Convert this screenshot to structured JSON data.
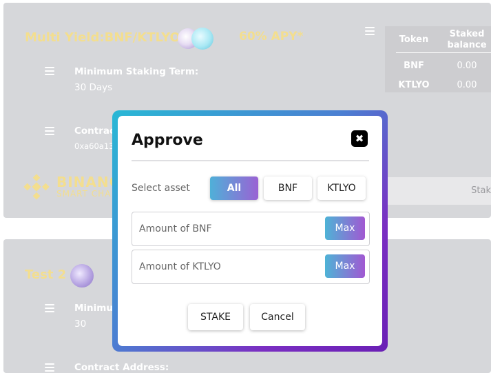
{
  "pool1": {
    "title": "Multi Yield:BNF/KTLYO",
    "apy": "60% APY*",
    "min_term_label": "Minimum Staking Term:",
    "min_term_value": "30 Days",
    "contract_label": "Contrac",
    "contract_value": "0xa60a13",
    "table": {
      "col_token": "Token",
      "col_staked_1": "Staked",
      "col_staked_2": "balance",
      "rows": [
        {
          "token": "BNF",
          "staked": "0.00"
        },
        {
          "token": "KTLYO",
          "staked": "0.00"
        }
      ]
    },
    "network_name": "BINANC",
    "network_sub": "SMART CHA",
    "stake_strip_text": "Stak"
  },
  "pool2": {
    "title": "Test 2",
    "min_term_label": "Minimu",
    "min_term_value": "30",
    "contract_label": "Contract Address:"
  },
  "modal": {
    "title": "Approve",
    "close_glyph": "✖",
    "select_asset_label": "Select asset",
    "tabs": [
      "All",
      "BNF",
      "KTLYO"
    ],
    "active_tab": "All",
    "fields": [
      {
        "placeholder": "Amount of BNF",
        "max_label": "Max"
      },
      {
        "placeholder": "Amount of KTLYO",
        "max_label": "Max"
      }
    ],
    "stake_label": "STAKE",
    "cancel_label": "Cancel"
  },
  "colors": {
    "accent_gradient_start": "#29b8d5",
    "accent_gradient_end": "#7a2fc2",
    "title_gold": "#f3de8f",
    "card_bg": "#d6d7da"
  }
}
